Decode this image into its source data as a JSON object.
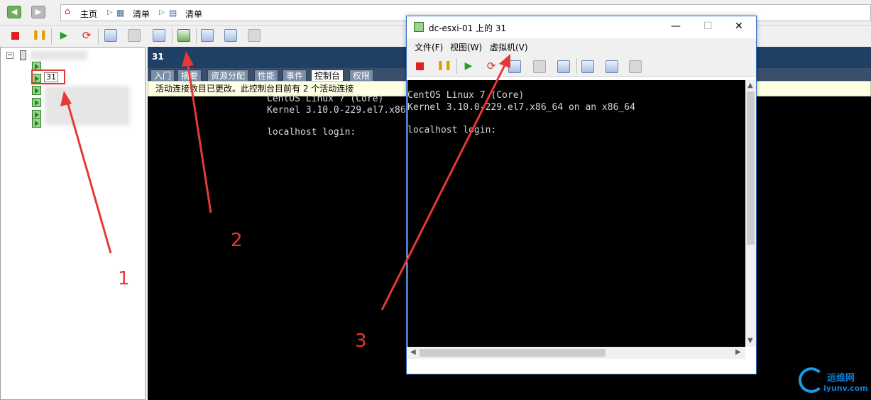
{
  "breadcrumb": {
    "home": "主页",
    "item1": "清单",
    "item2": "清单"
  },
  "tree": {
    "selected_vm": "31"
  },
  "main": {
    "title": "31",
    "tabs": [
      "入门",
      "摘要",
      "资源分配",
      "性能",
      "事件",
      "控制台",
      "权限"
    ],
    "active_tab": "控制台",
    "banner": "活动连接数目已更改。此控制台目前有 2 个活动连接",
    "console_lines": [
      "CentOS Linux 7 (Core)",
      "Kernel 3.10.0-229.el7.x86",
      "",
      "localhost login:"
    ]
  },
  "popup": {
    "title": "dc-esxi-01 上的 31",
    "menu": [
      "文件(F)",
      "视图(W)",
      "虚拟机(V)"
    ],
    "console_lines": [
      "CentOS Linux 7 (Core)",
      "Kernel 3.10.0-229.el7.x86_64 on an x86_64",
      "",
      "localhost login:"
    ]
  },
  "annotations": [
    "1",
    "2",
    "3"
  ],
  "watermark": {
    "name": "运维网",
    "url": "iyunv.com"
  },
  "colors": {
    "annotation": "#e53935",
    "header": "#1f3f64"
  }
}
